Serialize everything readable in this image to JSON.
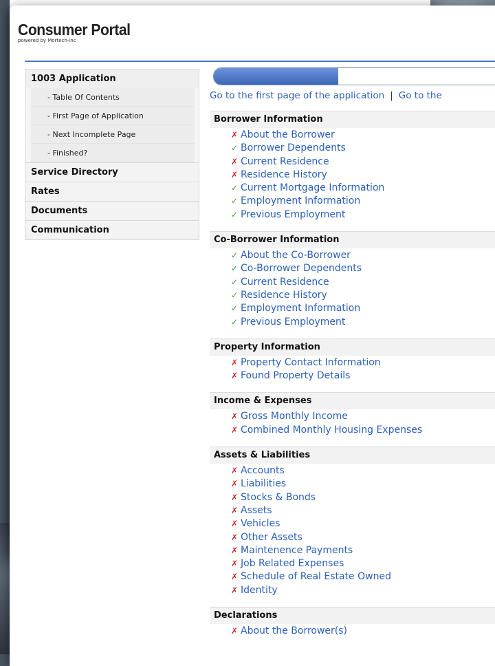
{
  "colors": {
    "accent": "#4a78c2",
    "link": "#2b5fb8",
    "incomplete": "#d32222",
    "complete": "#3aa33a"
  },
  "brand": {
    "title": "Consumer Portal",
    "subtitle": "powered by Mortech-inc"
  },
  "sidebar": {
    "sections": [
      {
        "label": "1003 Application",
        "items": [
          "- Table Of Contents",
          "- First Page of Application",
          "- Next Incomplete Page",
          "- Finished?"
        ]
      },
      {
        "label": "Service Directory",
        "items": []
      },
      {
        "label": "Rates",
        "items": []
      },
      {
        "label": "Documents",
        "items": []
      },
      {
        "label": "Communication",
        "items": []
      }
    ]
  },
  "progress": {
    "fraction": 0.43
  },
  "nav": {
    "first_page": "Go to the first page of the application",
    "separator": "|",
    "next": "Go to the"
  },
  "sections": [
    {
      "title": "Borrower Information",
      "items": [
        {
          "label": "About the Borrower",
          "done": false
        },
        {
          "label": "Borrower Dependents",
          "done": true
        },
        {
          "label": "Current Residence",
          "done": false
        },
        {
          "label": "Residence History",
          "done": false
        },
        {
          "label": "Current Mortgage Information",
          "done": true
        },
        {
          "label": "Employment Information",
          "done": true
        },
        {
          "label": "Previous Employment",
          "done": true
        }
      ]
    },
    {
      "title": "Co-Borrower Information",
      "items": [
        {
          "label": "About the Co-Borrower",
          "done": true
        },
        {
          "label": "Co-Borrower Dependents",
          "done": true
        },
        {
          "label": "Current Residence",
          "done": true
        },
        {
          "label": "Residence History",
          "done": true
        },
        {
          "label": "Employment Information",
          "done": true
        },
        {
          "label": "Previous Employment",
          "done": true
        }
      ]
    },
    {
      "title": "Property Information",
      "items": [
        {
          "label": "Property Contact Information",
          "done": false
        },
        {
          "label": "Found Property Details",
          "done": false
        }
      ]
    },
    {
      "title": "Income & Expenses",
      "items": [
        {
          "label": "Gross Monthly Income",
          "done": false
        },
        {
          "label": "Combined Monthly Housing Expenses",
          "done": false
        }
      ]
    },
    {
      "title": "Assets & Liabilities",
      "items": [
        {
          "label": "Accounts",
          "done": false
        },
        {
          "label": "Liabilities",
          "done": false
        },
        {
          "label": "Stocks & Bonds",
          "done": false
        },
        {
          "label": "Assets",
          "done": false
        },
        {
          "label": "Vehicles",
          "done": false
        },
        {
          "label": "Other Assets",
          "done": false
        },
        {
          "label": "Maintenence Payments",
          "done": false
        },
        {
          "label": "Job Related Expenses",
          "done": false
        },
        {
          "label": "Schedule of Real Estate Owned",
          "done": false
        },
        {
          "label": "Identity",
          "done": false
        }
      ]
    },
    {
      "title": "Declarations",
      "items": [
        {
          "label": "About the Borrower(s)",
          "done": false
        }
      ]
    }
  ]
}
